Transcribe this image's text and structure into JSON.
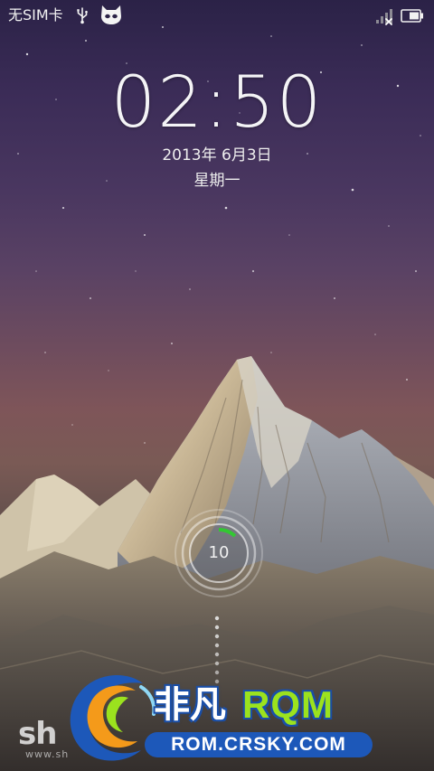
{
  "status_bar": {
    "carrier": "无SIM卡",
    "icons": [
      "usb-icon",
      "cyanogen-cat-icon",
      "no-signal-icon",
      "battery-icon"
    ]
  },
  "lockscreen": {
    "time": "02:50",
    "date": "2013年 6月3日",
    "weekday": "星期一",
    "unlock_counter": "10",
    "unlock_progress_fraction": 0.12
  },
  "watermark": {
    "shenduo": "sh",
    "shenduo_url": "www.sh",
    "brand_cn": "非凡",
    "brand_en": "RQM",
    "domain": "ROM.CRSKY.COM"
  },
  "colors": {
    "accent_green": "#32c832",
    "brand_blue": "#1d58b9",
    "brand_green": "#9be21e"
  }
}
